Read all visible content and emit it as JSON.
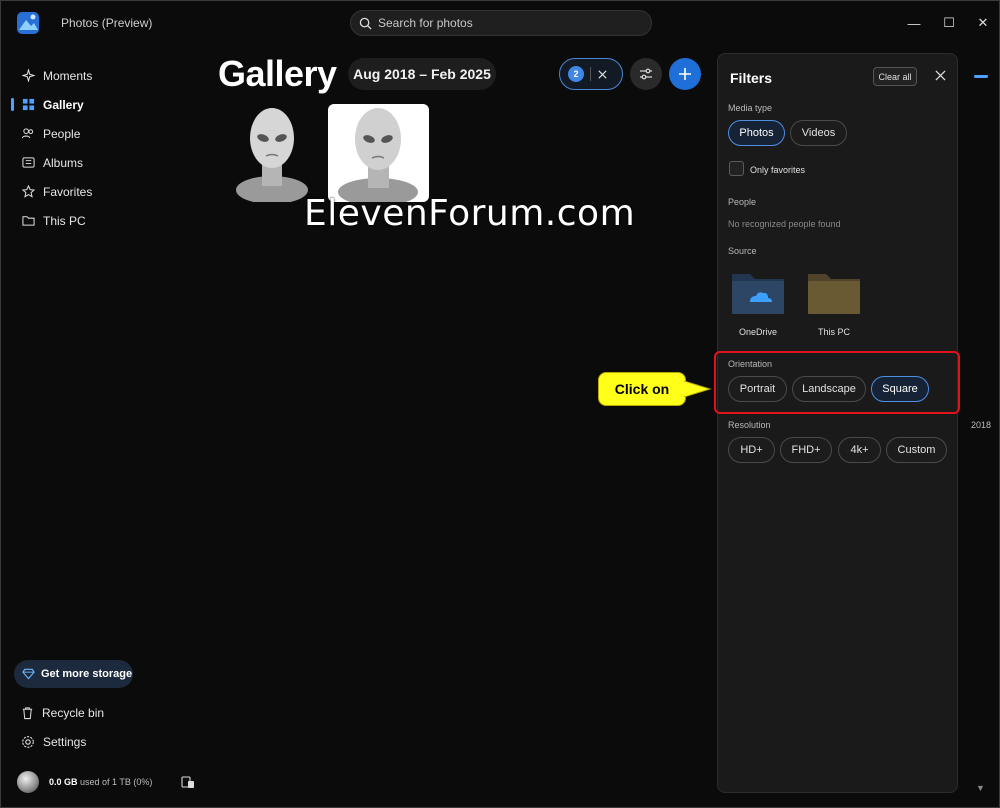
{
  "app": {
    "title": "Photos (Preview)",
    "window_controls": {
      "minimize": "—",
      "maximize": "☐",
      "close": "✕"
    }
  },
  "search": {
    "placeholder": "Search for photos"
  },
  "sidebar": {
    "items": [
      {
        "label": "Moments",
        "icon": "sparkle-icon"
      },
      {
        "label": "Gallery",
        "icon": "grid-icon",
        "active": true
      },
      {
        "label": "People",
        "icon": "people-icon"
      },
      {
        "label": "Albums",
        "icon": "album-icon"
      },
      {
        "label": "Favorites",
        "icon": "star-icon"
      },
      {
        "label": "This PC",
        "icon": "folder-icon"
      }
    ],
    "storage_button": "Get more storage",
    "recycle_bin": "Recycle bin",
    "settings": "Settings",
    "storage_used": "0.0 GB",
    "storage_total": "used of 1 TB (0%)"
  },
  "gallery": {
    "title": "Gallery",
    "date_range": "Aug 2018 – Feb 2025",
    "active_filter_count": "2",
    "watermark": "ElevenForum.com"
  },
  "filters": {
    "title": "Filters",
    "clear_all": "Clear all",
    "media_type": {
      "label": "Media type",
      "options": [
        "Photos",
        "Videos"
      ],
      "selected": "Photos"
    },
    "only_favorites": "Only favorites",
    "people": {
      "label": "People",
      "empty": "No recognized people found"
    },
    "source": {
      "label": "Source",
      "options": [
        "OneDrive",
        "This PC"
      ]
    },
    "orientation": {
      "label": "Orientation",
      "options": [
        "Portrait",
        "Landscape",
        "Square"
      ],
      "selected": "Square"
    },
    "resolution": {
      "label": "Resolution",
      "options": [
        "HD+",
        "FHD+",
        "4k+",
        "Custom"
      ]
    }
  },
  "callout": {
    "text": "Click on"
  },
  "timeline": {
    "year": "2018"
  },
  "colors": {
    "accent": "#3f86e6",
    "highlight": "#e0121b",
    "callout": "#ffff1a"
  }
}
